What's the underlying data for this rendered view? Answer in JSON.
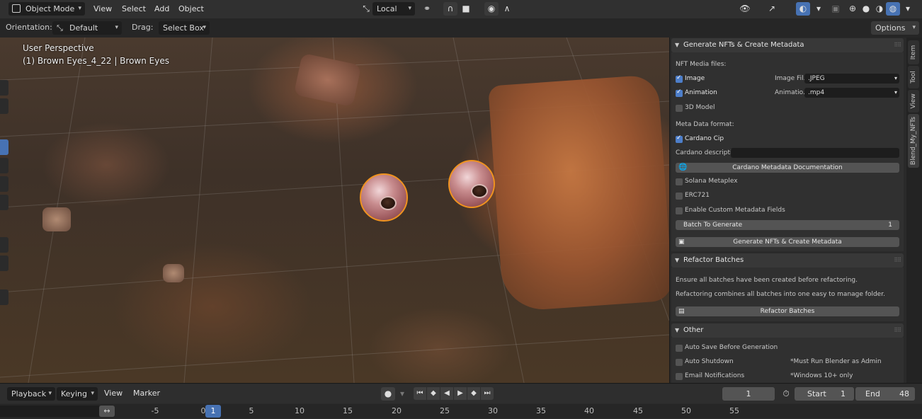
{
  "header": {
    "mode": "Object Mode",
    "menus": [
      "View",
      "Select",
      "Add",
      "Object"
    ],
    "transform_orientation": "Local",
    "options_label": "Options"
  },
  "tool_options": {
    "orientation_label": "Orientation:",
    "orientation_value": "Default",
    "drag_label": "Drag:",
    "drag_value": "Select Box"
  },
  "viewport": {
    "perspective": "User Perspective",
    "active_object": "(1) Brown Eyes_4_22 | Brown Eyes"
  },
  "panel_generate": {
    "title": "Generate NFTs & Create Metadata",
    "media_label": "NFT Media files:",
    "image": {
      "label": "Image",
      "checked": true,
      "type_label": "Image Fil...",
      "type_value": ".JPEG"
    },
    "animation": {
      "label": "Animation",
      "checked": true,
      "type_label": "Animatio...",
      "type_value": ".mp4"
    },
    "model": {
      "label": "3D Model",
      "checked": false
    },
    "meta_label": "Meta Data format:",
    "cardano_cip": {
      "label": "Cardano Cip",
      "checked": true
    },
    "cardano_desc_label": "Cardano descriptio",
    "cardano_doc_button": "Cardano Metadata Documentation",
    "solana": {
      "label": "Solana Metaplex",
      "checked": false
    },
    "erc721": {
      "label": "ERC721",
      "checked": false
    },
    "custom_fields": {
      "label": "Enable Custom Metadata Fields",
      "checked": false
    },
    "batch_label": "Batch To Generate",
    "batch_value": "1",
    "generate_button": "Generate NFTs & Create Metadata"
  },
  "panel_refactor": {
    "title": "Refactor Batches",
    "note1": "Ensure all batches have been created before refactoring.",
    "note2": "Refactoring combines all batches into one easy to manage folder.",
    "button": "Refactor Batches"
  },
  "panel_other": {
    "title": "Other",
    "auto_save": {
      "label": "Auto Save Before Generation",
      "checked": false
    },
    "auto_shutdown": {
      "label": "Auto Shutdown",
      "checked": false,
      "note": "*Must Run Blender as Admin"
    },
    "email": {
      "label": "Email Notifications",
      "checked": false,
      "note": "*Windows 10+ only"
    }
  },
  "tabs": [
    "Item",
    "Tool",
    "View",
    "Blend_My_NFTs"
  ],
  "timeline": {
    "menus": [
      "Playback",
      "Keying",
      "View",
      "Marker"
    ],
    "current_frame": "1",
    "start_label": "Start",
    "start_value": "1",
    "end_label": "End",
    "end_value": "48",
    "ruler": [
      "-5",
      "0",
      "5",
      "10",
      "15",
      "20",
      "25",
      "30",
      "35",
      "40",
      "45",
      "50",
      "55"
    ],
    "playhead": "1"
  }
}
